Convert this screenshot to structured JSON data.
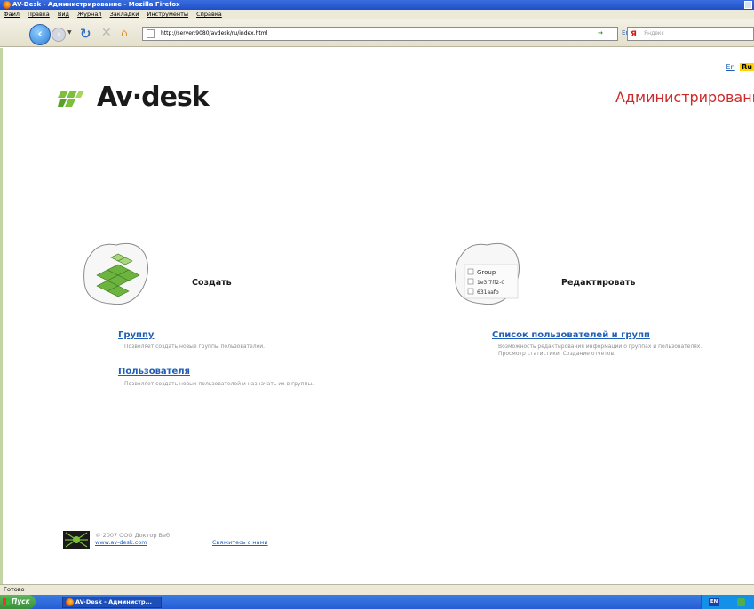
{
  "window": {
    "title": "AV-Desk - Администрирование - Mozilla Firefox"
  },
  "menu": {
    "items": [
      "Файл",
      "Правка",
      "Вид",
      "Журнал",
      "Закладки",
      "Инструменты",
      "Справка"
    ]
  },
  "navbar": {
    "url": "http://server:9080/avdesk/ru/index.html",
    "lang": "En",
    "search_placeholder": "Яндекс"
  },
  "page": {
    "lang_en": "En",
    "lang_ru": "Ru",
    "logo_text": "Av·desk",
    "admin_title": "Администрирование",
    "create": {
      "heading": "Создать",
      "group_link": "Группу",
      "group_desc": "Позволяет создать новые группы пользователей.",
      "user_link": "Пользователя",
      "user_desc": "Позволяет создать новых пользователей и назначать их в группы."
    },
    "edit": {
      "heading": "Редактировать",
      "list_link": "Список пользователей и групп",
      "list_desc": "Возможность редактирования информации о группах и пользователях. Просмотр статистики. Создание отчетов.",
      "icon_rows": [
        "Group",
        "1e3f7ff2-0",
        "631aafb"
      ]
    },
    "footer": {
      "copyright": "© 2007 ООО Доктор Веб",
      "site": "www.av-desk.com",
      "contact": "Свяжитесь с нами"
    }
  },
  "statusbar": {
    "text": "Готово"
  },
  "taskbar": {
    "start": "Пуск",
    "task": "AV-Desk - Администр...",
    "tray_lang": "EN"
  },
  "colors": {
    "accent_red": "#cc2a2a",
    "link_blue": "#1f5fb8",
    "logo_green": "#7cc03a"
  }
}
